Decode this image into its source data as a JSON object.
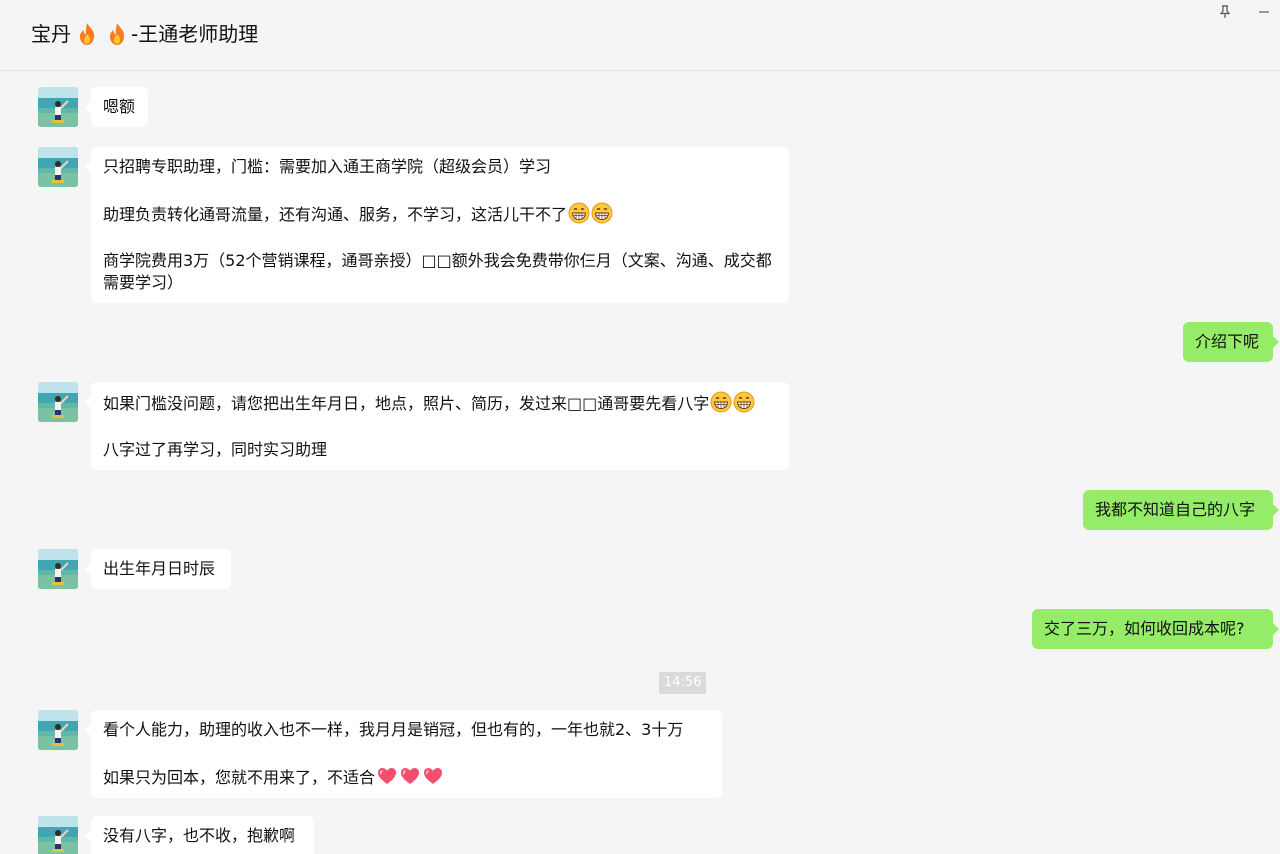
{
  "chat": {
    "title": "宝丹",
    "title_suffix": "-王通老师助理",
    "title_emoji": [
      "fire-icon",
      "fire-icon"
    ],
    "pin_icon": "pin-icon",
    "minimize_icon": "minimize-icon"
  },
  "messages": [
    {
      "side": "in",
      "paragraphs": [
        {
          "text": "嗯额"
        }
      ]
    },
    {
      "side": "in",
      "paragraphs": [
        {
          "text": "只招聘专职助理，门槛：需要加入通王商学院（超级会员）学习"
        },
        {
          "text": "助理负责转化通哥流量，还有沟通、服务，不学习，这活儿干不了",
          "emoji": [
            "grin-icon",
            "grin-icon"
          ]
        },
        {
          "text": "商学院费用3万（52个营销课程，通哥亲授）□□额外我会免费带你仨月（文案、沟通、成交都需要学习）"
        }
      ]
    },
    {
      "side": "out",
      "paragraphs": [
        {
          "text": "介绍下呢"
        }
      ]
    },
    {
      "side": "in",
      "paragraphs": [
        {
          "text": "如果门槛没问题，请您把出生年月日，地点，照片、简历，发过来□□通哥要先看八字",
          "emoji": [
            "grin-icon",
            "grin-icon"
          ]
        },
        {
          "text": "八字过了再学习，同时实习助理"
        }
      ]
    },
    {
      "side": "out",
      "paragraphs": [
        {
          "text": "我都不知道自己的八字"
        }
      ]
    },
    {
      "side": "in",
      "paragraphs": [
        {
          "text": "出生年月日时辰"
        }
      ]
    },
    {
      "side": "out",
      "paragraphs": [
        {
          "text": "交了三万，如何收回成本呢?"
        }
      ]
    },
    {
      "side": "in",
      "paragraphs": [
        {
          "text": "看个人能力，助理的收入也不一样，我月月是销冠，但也有的，一年也就2、3十万"
        },
        {
          "text": "如果只为回本，您就不用来了，不适合",
          "emoji": [
            "heart-icon",
            "heart-icon",
            "heart-icon"
          ]
        }
      ]
    },
    {
      "side": "in",
      "paragraphs": [
        {
          "text": "没有八字，也不收，抱歉啊"
        }
      ]
    }
  ],
  "timestamp": "14:56",
  "colors": {
    "incoming_bubble": "#ffffff",
    "outgoing_bubble": "#95ec69",
    "background": "#f5f5f5"
  }
}
